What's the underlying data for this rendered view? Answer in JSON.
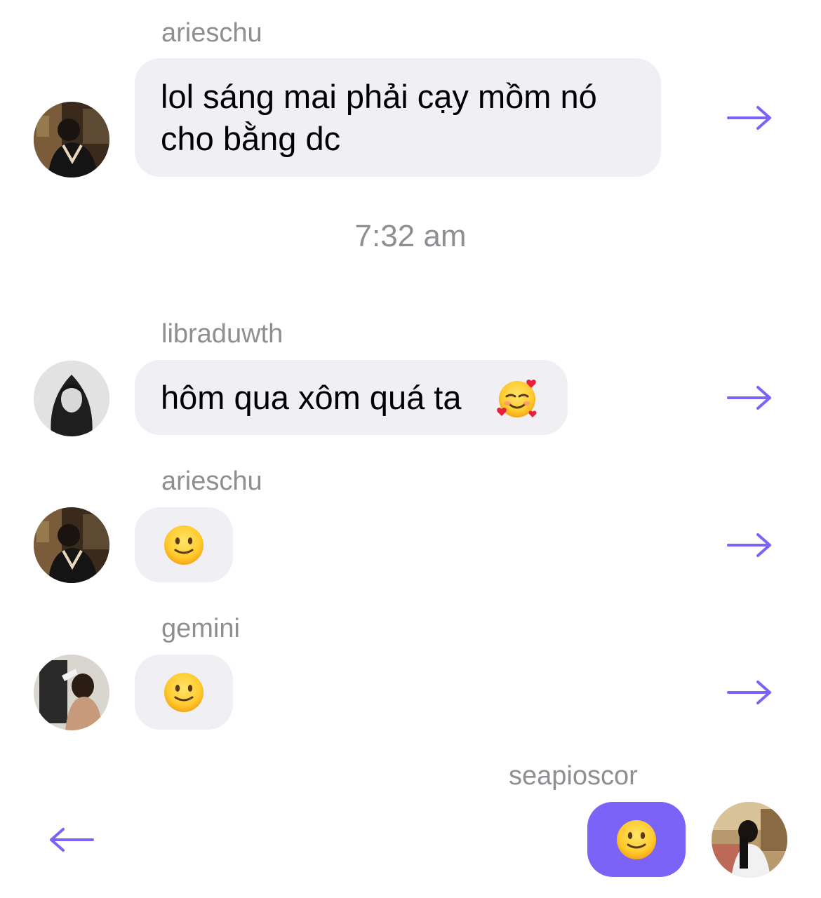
{
  "colors": {
    "accent": "#7b63f7",
    "bubble_gray": "#efeff4",
    "meta_text": "#8e8e93"
  },
  "messages": [
    {
      "sender": "arieschu",
      "lines": [
        "lol sáng mai phải cạy mồm nó",
        "cho bằng dc"
      ],
      "action_icon": "forward-arrow-icon"
    },
    {
      "sender": "libraduwth",
      "text": "hôm qua xôm quá ta",
      "emoji": "smiling-face-with-hearts",
      "action_icon": "forward-arrow-icon"
    },
    {
      "sender": "arieschu",
      "emoji": "slightly-smiling-face",
      "action_icon": "forward-arrow-icon"
    },
    {
      "sender": "gemini",
      "emoji": "slightly-smiling-face",
      "action_icon": "forward-arrow-icon"
    },
    {
      "sender": "seapioscor",
      "emoji": "slightly-smiling-face",
      "outgoing": true,
      "action_icon": "back-arrow-icon"
    }
  ],
  "timestamp": "7:32 am"
}
